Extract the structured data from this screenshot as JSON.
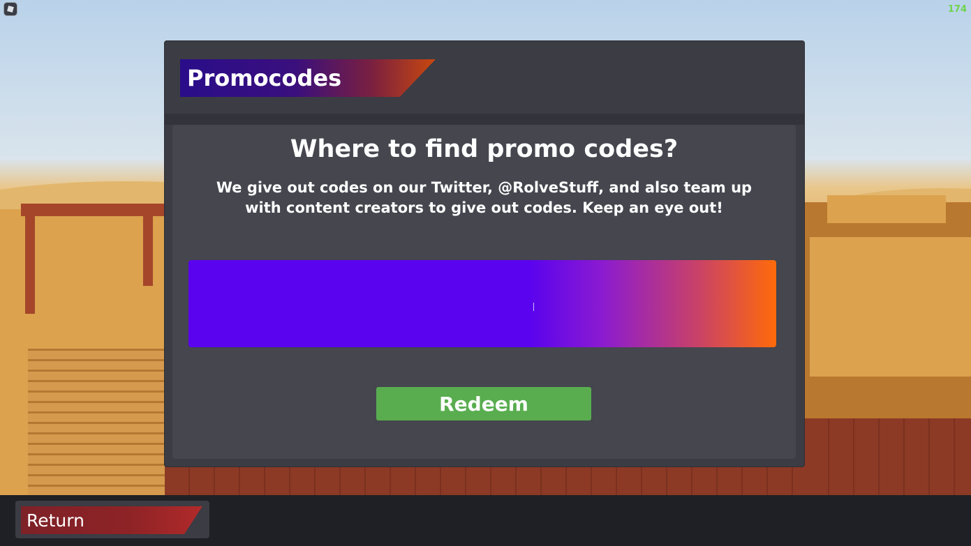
{
  "hud": {
    "fps_counter": "174",
    "roblox_menu_icon": "roblox-logo-icon"
  },
  "dialog": {
    "title": "Promocodes",
    "heading": "Where to find promo codes?",
    "description": "We give out codes on our Twitter, @RolveStuff, and also team up with content creators to give out codes. Keep an eye out!",
    "code_input_value": "",
    "redeem_label": "Redeem"
  },
  "bottom_bar": {
    "return_label": "Return"
  },
  "colors": {
    "panel": "#3b3c44",
    "input_gradient_start": "#5a03ee",
    "input_gradient_end": "#ff6a0a",
    "redeem_button": "#59ad4f",
    "return_button": "#8e2326",
    "fps_text": "#6fd34c"
  }
}
